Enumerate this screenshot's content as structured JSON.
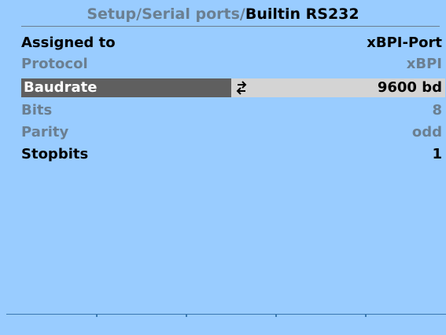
{
  "header": {
    "crumb_1": "Setup",
    "sep_1": "/",
    "crumb_2": "Serial ports",
    "sep_2": "/",
    "current": "Builtin RS232"
  },
  "settings": [
    {
      "label": "Assigned to",
      "value": "xBPI-Port",
      "state": "enabled"
    },
    {
      "label": "Protocol",
      "value": "xBPI",
      "state": "disabled"
    },
    {
      "label": "Baudrate",
      "value": "9600 bd",
      "state": "selected"
    },
    {
      "label": "Bits",
      "value": "8",
      "state": "disabled"
    },
    {
      "label": "Parity",
      "value": "odd",
      "state": "disabled"
    },
    {
      "label": "Stopbits",
      "value": "1",
      "state": "enabled"
    }
  ],
  "icons": {
    "selector": "cycle-arrows-icon"
  },
  "colors": {
    "background": "#99ccff",
    "text_enabled": "#000000",
    "text_disabled": "#6b7f91",
    "selected_label_bg": "#5f5f5f",
    "selected_value_bg": "#d4d4d4",
    "softkey_line": "#3a78b0"
  }
}
